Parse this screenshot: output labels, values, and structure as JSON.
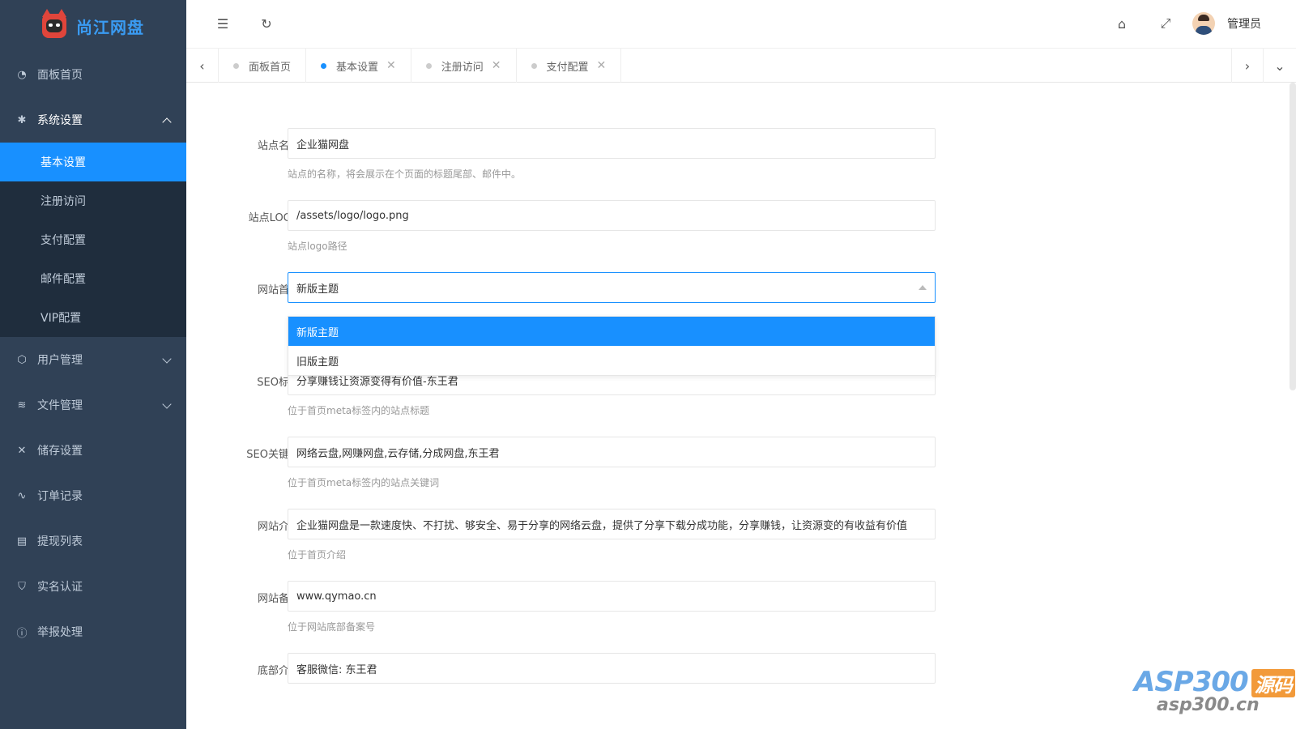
{
  "brand": {
    "name": "尚江网盘"
  },
  "sidebar": {
    "items": [
      {
        "label": "面板首页",
        "icon": "dashboard-icon"
      },
      {
        "label": "系统设置",
        "icon": "gear-icon",
        "open": true,
        "children": [
          "基本设置",
          "注册访问",
          "支付配置",
          "邮件配置",
          "VIP配置"
        ],
        "active_child": "基本设置"
      },
      {
        "label": "用户管理",
        "icon": "cube-icon"
      },
      {
        "label": "文件管理",
        "icon": "layers-icon"
      },
      {
        "label": "储存设置",
        "icon": "tools-icon"
      },
      {
        "label": "订单记录",
        "icon": "pulse-icon"
      },
      {
        "label": "提现列表",
        "icon": "document-icon"
      },
      {
        "label": "实名认证",
        "icon": "shield-check-icon"
      },
      {
        "label": "举报处理",
        "icon": "info-icon"
      }
    ]
  },
  "topbar": {
    "admin_name": "管理员"
  },
  "tabs": [
    {
      "label": "面板首页",
      "closable": false,
      "active": false
    },
    {
      "label": "基本设置",
      "closable": true,
      "active": true
    },
    {
      "label": "注册访问",
      "closable": true,
      "active": false
    },
    {
      "label": "支付配置",
      "closable": true,
      "active": false
    }
  ],
  "form": {
    "site_name": {
      "label": "站点名称",
      "value": "企业猫网盘",
      "hint": "站点的名称，将会展示在个页面的标题尾部、邮件中。"
    },
    "site_logo": {
      "label": "站点LOGO",
      "value": "/assets/logo/logo.png",
      "hint": "站点logo路径"
    },
    "homepage": {
      "label": "网站首页",
      "value": "新版主题",
      "options": [
        "新版主题",
        "旧版主题"
      ]
    },
    "seo_title": {
      "label": "SEO标题",
      "value": "分享赚钱让资源变得有价值-东王君",
      "hint": "位于首页meta标签内的站点标题"
    },
    "seo_keywords": {
      "label": "SEO关键词",
      "value": "网络云盘,网赚网盘,云存储,分成网盘,东王君",
      "hint": "位于首页meta标签内的站点关键词"
    },
    "site_intro": {
      "label": "网站介绍",
      "value": "企业猫网盘是一款速度快、不打扰、够安全、易于分享的网络云盘，提供了分享下载分成功能，分享赚钱，让资源变的有收益有价值",
      "hint": "位于首页介绍"
    },
    "icp": {
      "label": "网站备案",
      "value": "www.qymao.cn",
      "hint": "位于网站底部备案号"
    },
    "footer_intro": {
      "label": "底部介绍",
      "value": "客服微信: 东王君"
    }
  },
  "watermark": {
    "line1": "ASP300",
    "badge": "源码",
    "line2": "asp300.cn"
  }
}
